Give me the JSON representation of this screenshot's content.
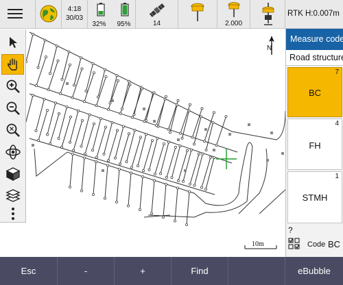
{
  "status": {
    "time": "4:18",
    "date": "30/03",
    "controller_battery": "32%",
    "receiver_battery": "95%",
    "satellites": "14",
    "antenna_height": "2.000",
    "rtk_precision": "RTK H:0.007m"
  },
  "toolbar": {
    "tools": [
      {
        "name": "select-tool",
        "icon": "cursor-arrow-icon"
      },
      {
        "name": "pan-tool",
        "icon": "hand-icon",
        "active": true
      },
      {
        "name": "zoom-in-tool",
        "icon": "zoom-in-icon"
      },
      {
        "name": "zoom-out-tool",
        "icon": "zoom-out-icon"
      },
      {
        "name": "zoom-extents-tool",
        "icon": "zoom-extents-icon"
      },
      {
        "name": "orbit-tool",
        "icon": "orbit-icon"
      },
      {
        "name": "view-cube-tool",
        "icon": "cube-icon"
      },
      {
        "name": "layers-tool",
        "icon": "layers-icon"
      },
      {
        "name": "more-tool",
        "icon": "more-vertical-icon"
      }
    ]
  },
  "map": {
    "north_label": "N",
    "scale_label": "10m"
  },
  "panel": {
    "title": "Measure codes",
    "group": "Road structure",
    "codes": [
      {
        "label": "BC",
        "count": "7",
        "selected": true
      },
      {
        "label": "FH",
        "count": "4",
        "selected": false
      },
      {
        "label": "STMH",
        "count": "1",
        "selected": false
      }
    ],
    "help": "?",
    "code_caption": "Code",
    "code_value": "BC"
  },
  "bottom": {
    "esc": "Esc",
    "minus": "-",
    "plus": "+",
    "find": "Find",
    "blank": "",
    "ebubble": "eBubble"
  },
  "colors": {
    "accent": "#f6b700",
    "panel_header": "#1763a6",
    "bottom_bar": "#4a4b63",
    "crosshair": "#1b9e2a"
  }
}
